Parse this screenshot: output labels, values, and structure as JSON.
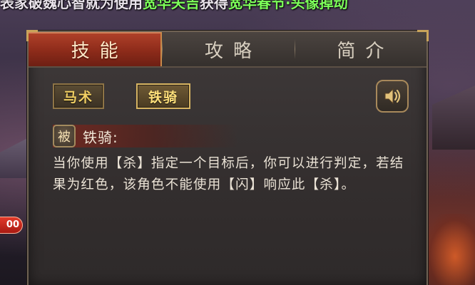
{
  "banner": {
    "segments": [
      {
        "text": "表家破魏心智就为使用",
        "color": "white"
      },
      {
        "text": "宽华夫吉",
        "color": "green"
      },
      {
        "text": "获得",
        "color": "white"
      },
      {
        "text": "宽华春节·头像掉动",
        "color": "green"
      }
    ]
  },
  "side_badge": "00",
  "tabs": [
    {
      "label": "技能",
      "active": true
    },
    {
      "label": "攻略",
      "active": false
    },
    {
      "label": "简介",
      "active": false
    }
  ],
  "skill_buttons": [
    {
      "label": "马术",
      "selected": false
    },
    {
      "label": "铁骑",
      "selected": true
    }
  ],
  "speaker_icon": "speaker-icon",
  "skill": {
    "type": "被",
    "name": "铁骑:",
    "description": "当你使用【杀】指定一个目标后，你可以进行判定，若结果为红色，该角色不能使用【闪】响应此【杀】。"
  },
  "colors": {
    "active_tab": "#9b3320",
    "gold_text": "#f1cf63",
    "panel_bg": "#3a3535"
  }
}
